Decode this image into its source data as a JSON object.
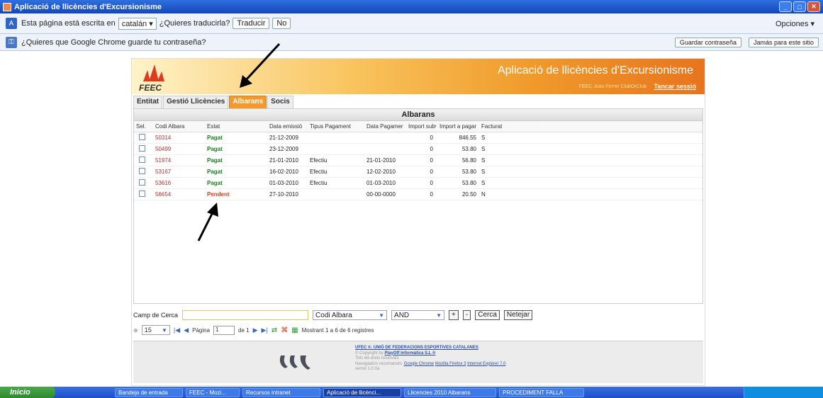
{
  "window": {
    "title": "Aplicació de llicències d'Excursionisme"
  },
  "translate_bar": {
    "prompt": "Esta página está escrita en",
    "language": "catalán ▾",
    "question": "¿Quieres traducirla?",
    "translate_btn": "Traducir",
    "no_btn": "No",
    "options": "Opciones ▾"
  },
  "password_bar": {
    "prompt": "¿Quieres que Google Chrome guarde tu contraseña?",
    "save_btn": "Guardar contraseña",
    "never_btn": "Jamás para este sitio"
  },
  "app": {
    "logo_text": "FEEC",
    "title": "Aplicació de llicències d'Excursionisme",
    "user_info": "FEEC  Joan Ferrer  ClubOrClub",
    "logout": "Tancar sessió",
    "tabs": [
      "Entitat",
      "Gestió Llicències",
      "Albarans",
      "Socis"
    ],
    "active_tab": "Albarans",
    "grid_title": "Albarans",
    "columns": [
      "Sel.",
      "Codi Albara",
      "Estat",
      "Data emissió",
      "Tipus Pagament",
      "Data Pagamer",
      "Import subv",
      "Import a pagar",
      "Facturat"
    ],
    "rows": [
      {
        "codi": "50314",
        "estat": "Pagat",
        "data": "21-12-2009",
        "tipus": "",
        "dpag": "",
        "imps": "0",
        "impp": "846.55",
        "fact": "S"
      },
      {
        "codi": "50499",
        "estat": "Pagat",
        "data": "23-12-2009",
        "tipus": "",
        "dpag": "",
        "imps": "0",
        "impp": "53.80",
        "fact": "S"
      },
      {
        "codi": "51974",
        "estat": "Pagat",
        "data": "21-01-2010",
        "tipus": "Efectiu",
        "dpag": "21-01-2010",
        "imps": "0",
        "impp": "56.80",
        "fact": "S"
      },
      {
        "codi": "53167",
        "estat": "Pagat",
        "data": "16-02-2010",
        "tipus": "Efectiu",
        "dpag": "12-02-2010",
        "imps": "0",
        "impp": "53.80",
        "fact": "S"
      },
      {
        "codi": "53616",
        "estat": "Pagat",
        "data": "01-03-2010",
        "tipus": "Efectiu",
        "dpag": "01-03-2010",
        "imps": "0",
        "impp": "53.80",
        "fact": "S"
      },
      {
        "codi": "56654",
        "estat": "Pendent",
        "data": "27-10-2010",
        "tipus": "",
        "dpag": "00-00-0000",
        "imps": "0",
        "impp": "20.50",
        "fact": "N"
      }
    ],
    "search": {
      "label": "Camp de Cerca",
      "value": "",
      "field": "Codi Albara",
      "operator": "AND",
      "add": "+",
      "remove": "-",
      "search_btn": "Cerca",
      "clear_btn": "Netejar"
    },
    "pager": {
      "page_size": "15",
      "page_label": "Pàgina",
      "page_value": "1",
      "of_label": "de 1",
      "summary": "Mostrant 1 a 6 de 6 registres"
    },
    "footer": {
      "org": "UFEC ®. UNIÓ DE FEDERACIONS ESPORTIVES CATALANES",
      "credit_prefix": "© Copyright by",
      "credit_link": "PlayOff Informàtica S.L ®",
      "line3": "Tots els drets reservats",
      "browsers_prefix": "Navegadors recomanats:",
      "browser1": "Google Chrome",
      "browser2": "Mozilla Firefox 3",
      "browser3": "Internet Explorer 7.0",
      "version": "versió 1.0.0a"
    }
  },
  "taskbar": {
    "start": "Inicio",
    "items": [
      "Bandeja de entrada",
      "FEEC - Mozi...",
      "Recursos intranet",
      "Aplicació de llicènci...",
      "Llicencies 2010 Albarans",
      "PROCEDIMENT FALLA"
    ]
  },
  "colors": {
    "accent": "#f59a2a",
    "paid": "#1b7a1b",
    "pending": "#d43b1e",
    "link": "#b2312d"
  }
}
